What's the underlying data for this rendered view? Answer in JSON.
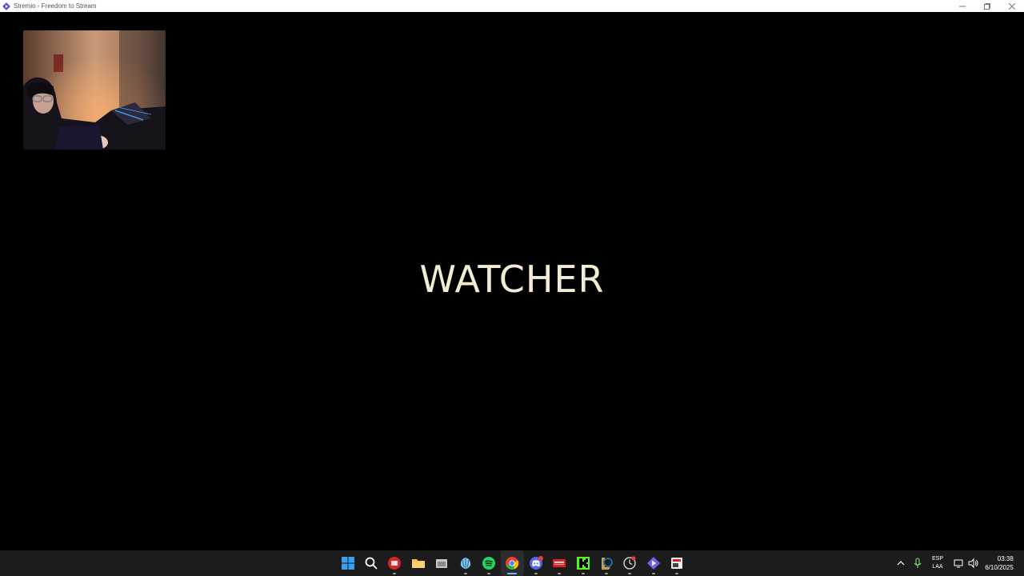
{
  "window": {
    "title": "Stremio - Freedom to Stream",
    "controls": [
      "minimize",
      "restore",
      "close"
    ]
  },
  "player": {
    "subtitle": "WATCHER"
  },
  "webcam_overlay": {
    "icon": "webcam-feed"
  },
  "taskbar": {
    "apps": [
      {
        "name": "start-icon"
      },
      {
        "name": "search-icon"
      },
      {
        "name": "app-red-icon"
      },
      {
        "name": "file-explorer-icon"
      },
      {
        "name": "app-folder-icon"
      },
      {
        "name": "app-shell-icon"
      },
      {
        "name": "spotify-icon"
      },
      {
        "name": "chrome-icon"
      },
      {
        "name": "discord-icon",
        "badge": "9+"
      },
      {
        "name": "vidio-icon"
      },
      {
        "name": "kick-icon"
      },
      {
        "name": "league-icon"
      },
      {
        "name": "app-clock-icon"
      },
      {
        "name": "stremio-icon"
      },
      {
        "name": "app-badge-icon"
      }
    ],
    "tray": {
      "lang_top": "ESP",
      "lang_bottom": "LAA",
      "time": "03:38",
      "date": "6/10/2025"
    }
  },
  "colors": {
    "subtitle": "#f3ecd2",
    "taskbar": "#1c1c1c",
    "accent": "#6bb6ff"
  }
}
